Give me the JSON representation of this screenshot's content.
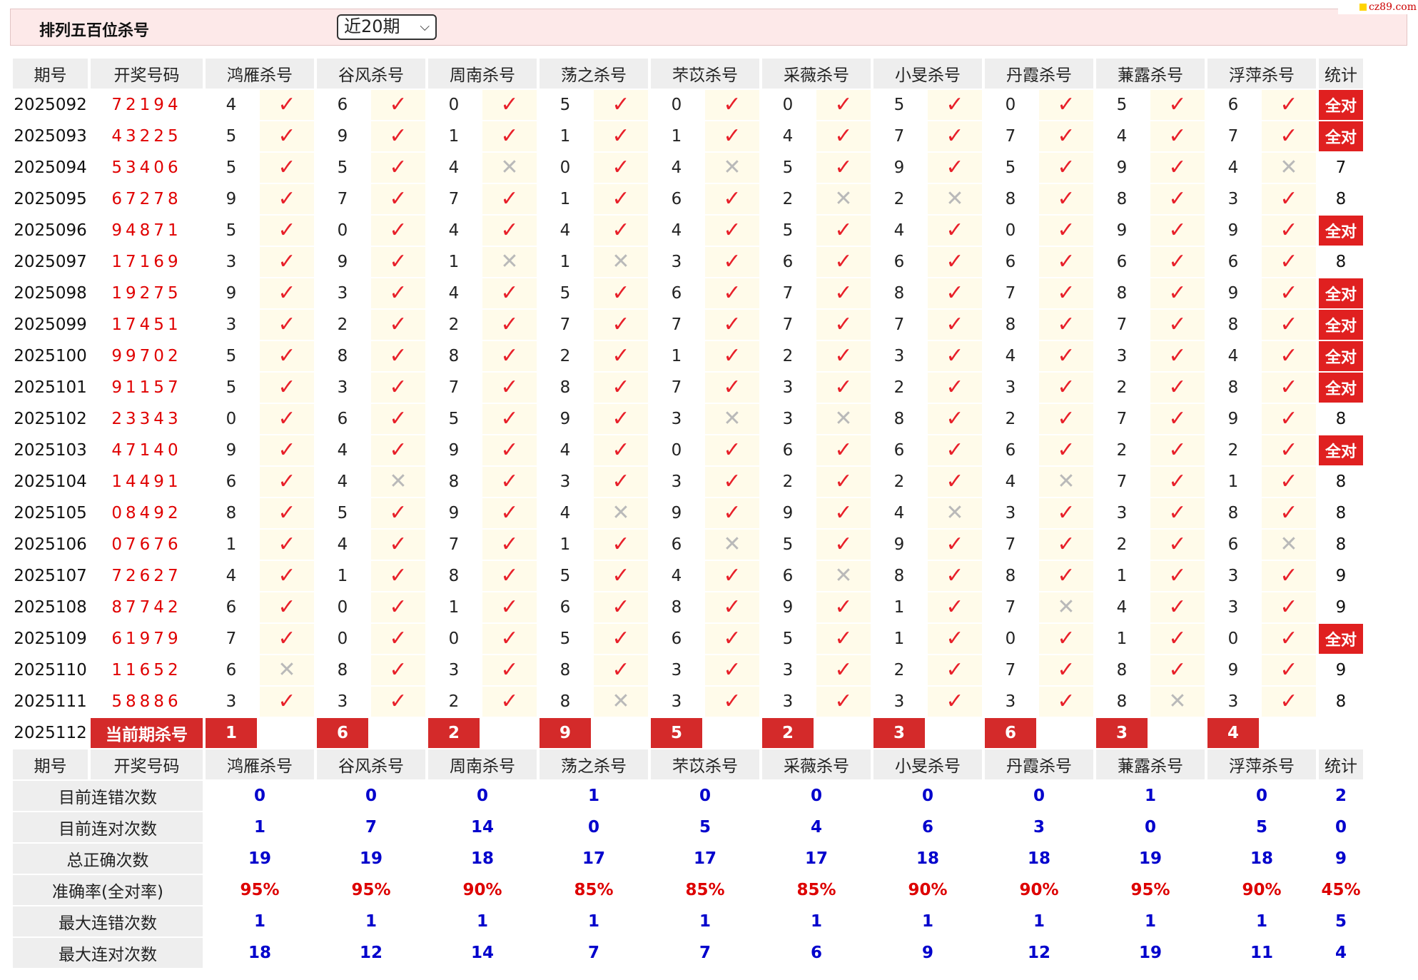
{
  "header": {
    "title": "排列五百位杀号",
    "period_selected": "近20期",
    "watermark": "cz89.com"
  },
  "columns": {
    "issue": "期号",
    "draw": "开奖号码",
    "stat": "统计"
  },
  "experts": [
    "鸿雁杀号",
    "谷风杀号",
    "周南杀号",
    "荡之杀号",
    "芣苡杀号",
    "采薇杀号",
    "小旻杀号",
    "丹霞杀号",
    "蒹露杀号",
    "浮萍杀号"
  ],
  "rows": [
    {
      "issue": "2025092",
      "draw": "72194",
      "kills": [
        4,
        6,
        0,
        5,
        0,
        0,
        5,
        0,
        5,
        6
      ],
      "ok": [
        1,
        1,
        1,
        1,
        1,
        1,
        1,
        1,
        1,
        1
      ],
      "stat": "全对"
    },
    {
      "issue": "2025093",
      "draw": "43225",
      "kills": [
        5,
        9,
        1,
        1,
        1,
        4,
        7,
        7,
        4,
        7
      ],
      "ok": [
        1,
        1,
        1,
        1,
        1,
        1,
        1,
        1,
        1,
        1
      ],
      "stat": "全对"
    },
    {
      "issue": "2025094",
      "draw": "53406",
      "kills": [
        5,
        5,
        4,
        0,
        4,
        5,
        9,
        5,
        9,
        4
      ],
      "ok": [
        1,
        1,
        0,
        1,
        0,
        1,
        1,
        1,
        1,
        0
      ],
      "stat": "7"
    },
    {
      "issue": "2025095",
      "draw": "67278",
      "kills": [
        9,
        7,
        7,
        1,
        6,
        2,
        2,
        8,
        8,
        3
      ],
      "ok": [
        1,
        1,
        1,
        1,
        1,
        0,
        0,
        1,
        1,
        1
      ],
      "stat": "8"
    },
    {
      "issue": "2025096",
      "draw": "94871",
      "kills": [
        5,
        0,
        4,
        4,
        4,
        5,
        4,
        0,
        9,
        9
      ],
      "ok": [
        1,
        1,
        1,
        1,
        1,
        1,
        1,
        1,
        1,
        1
      ],
      "stat": "全对"
    },
    {
      "issue": "2025097",
      "draw": "17169",
      "kills": [
        3,
        9,
        1,
        1,
        3,
        6,
        6,
        6,
        6,
        6
      ],
      "ok": [
        1,
        1,
        0,
        0,
        1,
        1,
        1,
        1,
        1,
        1
      ],
      "stat": "8"
    },
    {
      "issue": "2025098",
      "draw": "19275",
      "kills": [
        9,
        3,
        4,
        5,
        6,
        7,
        8,
        7,
        8,
        9
      ],
      "ok": [
        1,
        1,
        1,
        1,
        1,
        1,
        1,
        1,
        1,
        1
      ],
      "stat": "全对"
    },
    {
      "issue": "2025099",
      "draw": "17451",
      "kills": [
        3,
        2,
        2,
        7,
        7,
        7,
        7,
        8,
        7,
        8
      ],
      "ok": [
        1,
        1,
        1,
        1,
        1,
        1,
        1,
        1,
        1,
        1
      ],
      "stat": "全对"
    },
    {
      "issue": "2025100",
      "draw": "99702",
      "kills": [
        5,
        8,
        8,
        2,
        1,
        2,
        3,
        4,
        3,
        4
      ],
      "ok": [
        1,
        1,
        1,
        1,
        1,
        1,
        1,
        1,
        1,
        1
      ],
      "stat": "全对"
    },
    {
      "issue": "2025101",
      "draw": "91157",
      "kills": [
        5,
        3,
        7,
        8,
        7,
        3,
        2,
        3,
        2,
        8
      ],
      "ok": [
        1,
        1,
        1,
        1,
        1,
        1,
        1,
        1,
        1,
        1
      ],
      "stat": "全对"
    },
    {
      "issue": "2025102",
      "draw": "23343",
      "kills": [
        0,
        6,
        5,
        9,
        3,
        3,
        8,
        2,
        7,
        9
      ],
      "ok": [
        1,
        1,
        1,
        1,
        0,
        0,
        1,
        1,
        1,
        1
      ],
      "stat": "8"
    },
    {
      "issue": "2025103",
      "draw": "47140",
      "kills": [
        9,
        4,
        9,
        4,
        0,
        6,
        6,
        6,
        2,
        2
      ],
      "ok": [
        1,
        1,
        1,
        1,
        1,
        1,
        1,
        1,
        1,
        1
      ],
      "stat": "全对"
    },
    {
      "issue": "2025104",
      "draw": "14491",
      "kills": [
        6,
        4,
        8,
        3,
        3,
        2,
        2,
        4,
        7,
        1
      ],
      "ok": [
        1,
        0,
        1,
        1,
        1,
        1,
        1,
        0,
        1,
        1
      ],
      "stat": "8"
    },
    {
      "issue": "2025105",
      "draw": "08492",
      "kills": [
        8,
        5,
        9,
        4,
        9,
        9,
        4,
        3,
        3,
        8
      ],
      "ok": [
        1,
        1,
        1,
        0,
        1,
        1,
        0,
        1,
        1,
        1
      ],
      "stat": "8"
    },
    {
      "issue": "2025106",
      "draw": "07676",
      "kills": [
        1,
        4,
        7,
        1,
        6,
        5,
        9,
        7,
        2,
        6
      ],
      "ok": [
        1,
        1,
        1,
        1,
        0,
        1,
        1,
        1,
        1,
        0
      ],
      "stat": "8"
    },
    {
      "issue": "2025107",
      "draw": "72627",
      "kills": [
        4,
        1,
        8,
        5,
        4,
        6,
        8,
        8,
        1,
        3
      ],
      "ok": [
        1,
        1,
        1,
        1,
        1,
        0,
        1,
        1,
        1,
        1
      ],
      "stat": "9"
    },
    {
      "issue": "2025108",
      "draw": "87742",
      "kills": [
        6,
        0,
        1,
        6,
        8,
        9,
        1,
        7,
        4,
        3
      ],
      "ok": [
        1,
        1,
        1,
        1,
        1,
        1,
        1,
        0,
        1,
        1
      ],
      "stat": "9"
    },
    {
      "issue": "2025109",
      "draw": "61979",
      "kills": [
        7,
        0,
        0,
        5,
        6,
        5,
        1,
        0,
        1,
        0
      ],
      "ok": [
        1,
        1,
        1,
        1,
        1,
        1,
        1,
        1,
        1,
        1
      ],
      "stat": "全对"
    },
    {
      "issue": "2025110",
      "draw": "11652",
      "kills": [
        6,
        8,
        3,
        8,
        3,
        3,
        2,
        7,
        8,
        9
      ],
      "ok": [
        0,
        1,
        1,
        1,
        1,
        1,
        1,
        1,
        1,
        1
      ],
      "stat": "9"
    },
    {
      "issue": "2025111",
      "draw": "58886",
      "kills": [
        3,
        3,
        2,
        8,
        3,
        3,
        3,
        3,
        8,
        3
      ],
      "ok": [
        1,
        1,
        1,
        0,
        1,
        1,
        1,
        1,
        0,
        1
      ],
      "stat": "8"
    }
  ],
  "current": {
    "issue": "2025112",
    "label": "当前期杀号",
    "kills": [
      1,
      6,
      2,
      9,
      5,
      2,
      3,
      6,
      3,
      4
    ]
  },
  "summary": [
    {
      "label": "目前连错次数",
      "values": [
        "0",
        "0",
        "0",
        "1",
        "0",
        "0",
        "0",
        "0",
        "1",
        "0"
      ],
      "stat": "2",
      "type": "count"
    },
    {
      "label": "目前连对次数",
      "values": [
        "1",
        "7",
        "14",
        "0",
        "5",
        "4",
        "6",
        "3",
        "0",
        "5"
      ],
      "stat": "0",
      "type": "count"
    },
    {
      "label": "总正确次数",
      "values": [
        "19",
        "19",
        "18",
        "17",
        "17",
        "17",
        "18",
        "18",
        "19",
        "18"
      ],
      "stat": "9",
      "type": "count"
    },
    {
      "label": "准确率(全对率)",
      "values": [
        "95%",
        "95%",
        "90%",
        "85%",
        "85%",
        "85%",
        "90%",
        "90%",
        "95%",
        "90%"
      ],
      "stat": "45%",
      "type": "rate"
    },
    {
      "label": "最大连错次数",
      "values": [
        "1",
        "1",
        "1",
        "1",
        "1",
        "1",
        "1",
        "1",
        "1",
        "1"
      ],
      "stat": "5",
      "type": "count"
    },
    {
      "label": "最大连对次数",
      "values": [
        "18",
        "12",
        "14",
        "7",
        "7",
        "6",
        "9",
        "12",
        "19",
        "11"
      ],
      "stat": "4",
      "type": "count"
    }
  ],
  "colors": {
    "check": "#e8202a",
    "cross": "#b9b9b9",
    "all_correct_bg": "#e02020",
    "current_bg": "#d42a2a",
    "count_text": "#0000cc",
    "rate_text": "#dd0000"
  },
  "icons": {
    "correct": "check-icon",
    "wrong": "cross-icon"
  }
}
